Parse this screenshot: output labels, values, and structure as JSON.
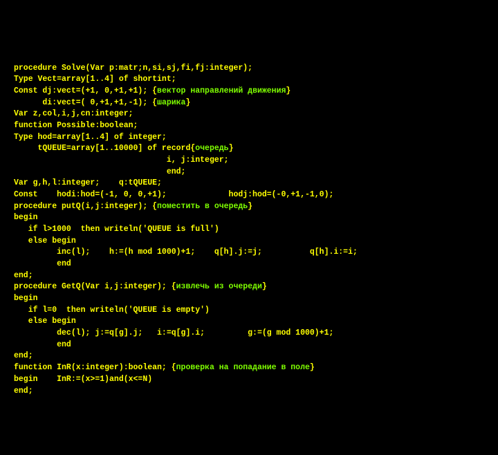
{
  "lines": [
    [
      {
        "cls": "y",
        "t": "procedure Solve(Var p:matr;n,si,sj,fi,fj:integer);"
      }
    ],
    [
      {
        "cls": "y",
        "t": "Type Vect=array[1..4] of shortint;"
      }
    ],
    [
      {
        "cls": "y",
        "t": "Const dj:vect=(+1, 0,+1,+1); {"
      },
      {
        "cls": "g",
        "t": "вектор направлений движения"
      },
      {
        "cls": "y",
        "t": "}"
      }
    ],
    [
      {
        "cls": "y",
        "t": "      di:vect=( 0,+1,+1,-1); {"
      },
      {
        "cls": "g",
        "t": "шарика"
      },
      {
        "cls": "y",
        "t": "}"
      }
    ],
    [
      {
        "cls": "y",
        "t": "Var z,col,i,j,cn:integer;"
      }
    ],
    [
      {
        "cls": "y",
        "t": "function Possible:boolean;"
      }
    ],
    [
      {
        "cls": "y",
        "t": "Type hod=array[1..4] of integer;"
      }
    ],
    [
      {
        "cls": "y",
        "t": "     tQUEUE=array[1..10000] of record{"
      },
      {
        "cls": "g",
        "t": "очередь"
      },
      {
        "cls": "y",
        "t": "}"
      }
    ],
    [
      {
        "cls": "y",
        "t": "                                i, j:integer;"
      }
    ],
    [
      {
        "cls": "y",
        "t": "                                end;"
      }
    ],
    [
      {
        "cls": "y",
        "t": "Var g,h,l:integer;    q:tQUEUE;"
      }
    ],
    [
      {
        "cls": "y",
        "t": "Const    hodi:hod=(-1, 0, 0,+1);             hodj:hod=(-0,+1,-1,0);"
      }
    ],
    [
      {
        "cls": "y",
        "t": "procedure putQ(i,j:integer); {"
      },
      {
        "cls": "g",
        "t": "поместить в очередь"
      },
      {
        "cls": "y",
        "t": "}"
      }
    ],
    [
      {
        "cls": "y",
        "t": "begin"
      }
    ],
    [
      {
        "cls": "y",
        "t": "   if l>1000  then writeln('QUEUE is full')"
      }
    ],
    [
      {
        "cls": "y",
        "t": "   else begin"
      }
    ],
    [
      {
        "cls": "y",
        "t": "         inc(l);    h:=(h mod 1000)+1;    q[h].j:=j;          q[h].i:=i;"
      }
    ],
    [
      {
        "cls": "y",
        "t": "         end"
      }
    ],
    [
      {
        "cls": "y",
        "t": "end;"
      }
    ],
    [
      {
        "cls": "y",
        "t": "procedure GetQ(Var i,j:integer); {"
      },
      {
        "cls": "g",
        "t": "извлечь из очереди"
      },
      {
        "cls": "y",
        "t": "}"
      }
    ],
    [
      {
        "cls": "y",
        "t": "begin"
      }
    ],
    [
      {
        "cls": "y",
        "t": "   if l=0  then writeln('QUEUE is empty')"
      }
    ],
    [
      {
        "cls": "y",
        "t": "   else begin"
      }
    ],
    [
      {
        "cls": "y",
        "t": "         dec(l); j:=q[g].j;   i:=q[g].i;         g:=(g mod 1000)+1;"
      }
    ],
    [
      {
        "cls": "y",
        "t": "         end"
      }
    ],
    [
      {
        "cls": "y",
        "t": "end;"
      }
    ],
    [
      {
        "cls": "y",
        "t": "function InR(x:integer):boolean; {"
      },
      {
        "cls": "g",
        "t": "проверка на попадание в поле"
      },
      {
        "cls": "y",
        "t": "}"
      }
    ],
    [
      {
        "cls": "y",
        "t": "begin    InR:=(x>=1)and(x<=N)"
      }
    ],
    [
      {
        "cls": "y",
        "t": "end;"
      }
    ]
  ]
}
